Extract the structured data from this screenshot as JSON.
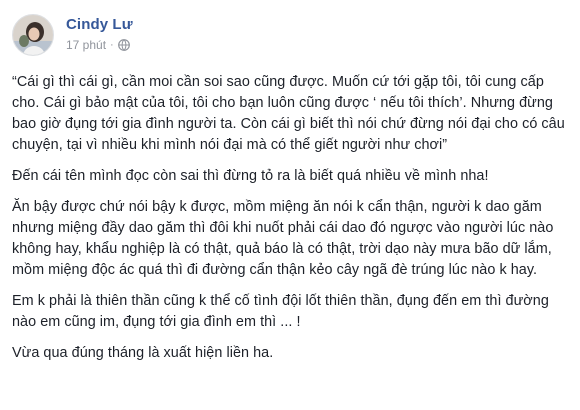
{
  "post": {
    "author_name": "Cindy Lư",
    "timestamp": "17 phút",
    "separator": "·",
    "privacy_icon": "globe-icon",
    "paragraphs": [
      "“Cái gì thì cái gì, cần moi cần soi sao cũng được. Muốn cứ tới gặp tôi, tôi cung cấp cho. Cái gì bảo mật của tôi, tôi cho bạn luôn cũng được ‘ nếu tôi thích’. Nhưng đừng bao giờ đụng tới gia đình người ta. Còn cái gì biết thì nói chứ đừng nói đại cho có câu chuyện, tại vì nhiều khi mình nói đại mà có thể giết người như chơi”",
      "Đến cái tên mình đọc còn sai thì đừng tỏ ra là biết quá nhiều về mình nha!",
      "Ăn bậy được chứ nói bậy k được, mồm miệng ăn nói k cẩn thận, người k dao găm nhưng miệng đầy dao găm thì đôi khi nuốt phải cái dao đó ngược vào người lúc nào không hay, khẩu nghiệp là có thật, quả báo là có thật, trời dạo này mưa bão dữ lắm, mồm miệng độc ác quá thì đi đường cẩn thận kẻo cây ngã đè trúng lúc nào k hay.",
      "Em k phải là thiên thần cũng k thể cố tình đội lốt thiên thần, đụng đến em thì đường nào em cũng im, đụng tới gia đình em thì ... !",
      "Vừa qua đúng tháng là xuất hiện liền ha."
    ]
  },
  "colors": {
    "author": "#365899",
    "text": "#1d2129",
    "meta": "#90949c",
    "background": "#ffffff"
  }
}
